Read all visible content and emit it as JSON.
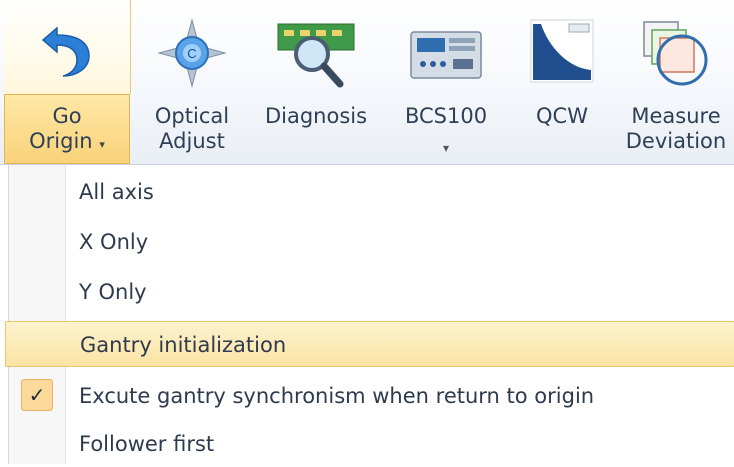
{
  "ribbon": {
    "buttons": [
      {
        "id": "go_origin",
        "line1": "Go",
        "line2": "Origin",
        "caret": "▾",
        "icon": "undo-arrow-icon"
      },
      {
        "id": "optical_adjust",
        "line1": "Optical",
        "line2": "Adjust",
        "icon": "compass-icon"
      },
      {
        "id": "diagnosis",
        "line1": "Diagnosis",
        "icon": "magnifier-circuit-icon"
      },
      {
        "id": "bcs100",
        "line1": "BCS100",
        "caret": "▾",
        "icon": "controller-panel-icon"
      },
      {
        "id": "qcw",
        "line1": "QCW",
        "icon": "qcw-curve-icon"
      },
      {
        "id": "measure_deviation",
        "line1": "Measure",
        "line2": "Deviation",
        "icon": "layers-target-icon"
      }
    ]
  },
  "menu": {
    "items": [
      {
        "label": "All axis",
        "checked": false,
        "highlighted": false
      },
      {
        "label": "X Only",
        "checked": false,
        "highlighted": false
      },
      {
        "label": "Y Only",
        "checked": false,
        "highlighted": false
      },
      {
        "label": "Gantry initialization",
        "checked": false,
        "highlighted": true
      },
      {
        "label": "Excute gantry synchronism when return to origin",
        "checked": true,
        "highlighted": false
      },
      {
        "label": "Follower first",
        "checked": false,
        "highlighted": false
      }
    ],
    "check_glyph": "✓"
  },
  "colors": {
    "highlight": "#fbe3a3",
    "pressed": "#f9d27a",
    "text": "#2e3a4d"
  }
}
